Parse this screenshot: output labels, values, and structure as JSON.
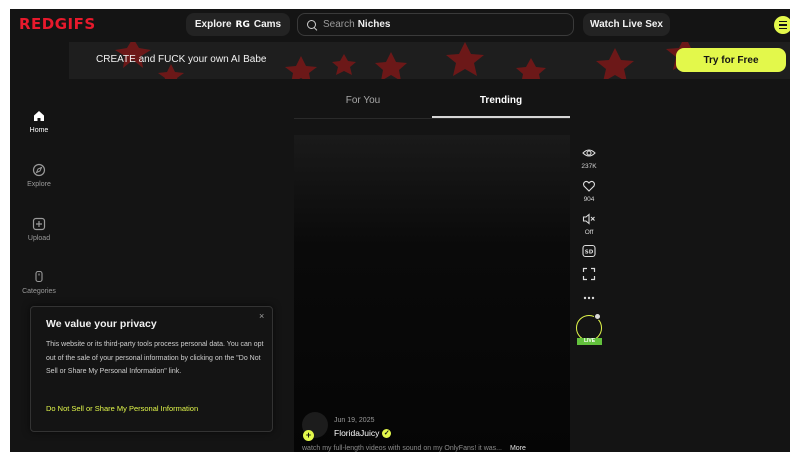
{
  "colors": {
    "accent": "#e3f84b",
    "logo": "#e8192c",
    "live": "#63c13d",
    "background": "#141414"
  },
  "nav": {
    "logo": "REDGIFS",
    "explore_prefix": "Explore",
    "explore_mark": "RG",
    "explore_suffix": "Cams",
    "search_placeholder": "Search",
    "search_suggestion": "Niches",
    "watch_live": "Watch Live Sex",
    "menu_icon": "hamburger-icon"
  },
  "banner": {
    "text": "CREATE and FUCK your own AI Babe",
    "cta": "Try for Free"
  },
  "sidebar": {
    "items": [
      {
        "label": "Home",
        "icon": "home-icon",
        "active": true
      },
      {
        "label": "Explore",
        "icon": "compass-icon",
        "active": false
      },
      {
        "label": "Upload",
        "icon": "upload-icon",
        "active": false
      },
      {
        "label": "Categories",
        "icon": "categories-icon",
        "active": false
      }
    ]
  },
  "tabs": [
    {
      "label": "For You",
      "active": false
    },
    {
      "label": "Trending",
      "active": true
    }
  ],
  "post": {
    "date": "Jun 19, 2025",
    "username": "FloridaJuicy",
    "caption": "watch my full-length videos with sound on my OnlyFans! it was...",
    "more": "More"
  },
  "actions": {
    "views": "237K",
    "likes": "904",
    "sound": "Off",
    "quality": "SD",
    "live_badge": "LIVE"
  },
  "privacy": {
    "title": "We value your privacy",
    "close": "×",
    "body": "This website or its third-party tools process personal data. You can opt out of the sale of your personal information by clicking on the \"Do Not Sell or Share My Personal Information\" link.",
    "link": "Do Not Sell or Share My Personal Information"
  }
}
